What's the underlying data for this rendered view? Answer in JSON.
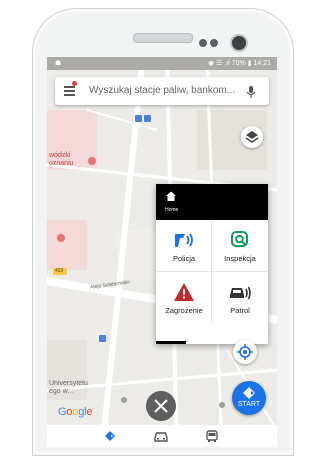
{
  "statusbar": {
    "left_icons": "☗",
    "right_text": "◉ ☰ .ıl 70% ▮ 14:21",
    "time": "14:21",
    "battery": "70%"
  },
  "search": {
    "placeholder": "Wyszukaj stacje paliw, bankom..."
  },
  "map": {
    "labels": {
      "place_1": "wódzki",
      "place_2": "oznaniu",
      "place_3": "Universytetu",
      "place_4": "ego w...",
      "route_badge": "433"
    },
    "streets": {
      "street_1": "Aleje Solidarności"
    }
  },
  "quick_menu": {
    "home_label": "Home",
    "tiles": [
      {
        "label": "Policja",
        "icon": "police-radar-icon",
        "color": "#1a73e8"
      },
      {
        "label": "Inspekcja",
        "icon": "camera-icon",
        "color": "#0f9d58"
      },
      {
        "label": "Zagrożenie",
        "icon": "warning-icon",
        "color": "#c62828"
      },
      {
        "label": "Patrol",
        "icon": "car-patrol-icon",
        "color": "#333333"
      }
    ]
  },
  "start_button": {
    "label": "START",
    "color": "#1a73e8"
  },
  "google_logo": "Google",
  "bottom_nav": [
    {
      "icon": "navigation-icon",
      "color": "#1a73e8"
    },
    {
      "icon": "car-icon",
      "color": "#555555"
    },
    {
      "icon": "bus-icon",
      "color": "#555555"
    }
  ]
}
